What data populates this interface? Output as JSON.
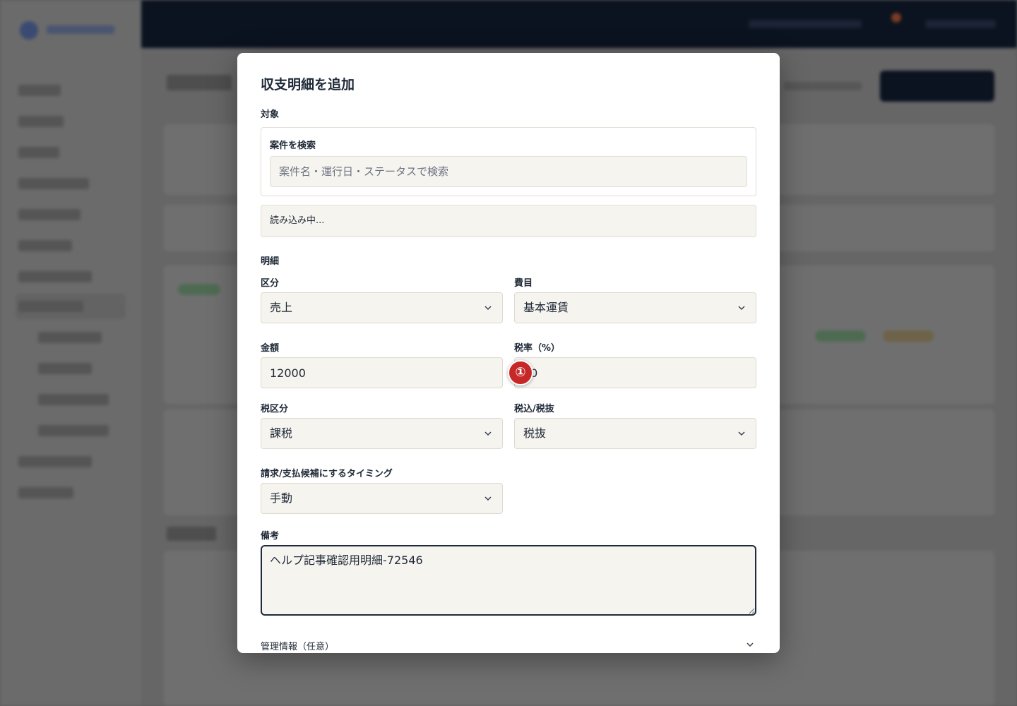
{
  "modal": {
    "title": "収支明細を追加",
    "target_section": "対象",
    "search": {
      "label": "案件を検索",
      "placeholder": "案件名・運行日・ステータスで検索",
      "value": ""
    },
    "loading_text": "読み込み中...",
    "detail_section": "明細",
    "fields": {
      "category": {
        "label": "区分",
        "value": "売上"
      },
      "item": {
        "label": "費目",
        "value": "基本運賃"
      },
      "amount": {
        "label": "金額",
        "value": "12000"
      },
      "tax_rate": {
        "label": "税率（%）",
        "value": "10"
      },
      "tax_class": {
        "label": "税区分",
        "value": "課税"
      },
      "tax_mode": {
        "label": "税込/税抜",
        "value": "税抜"
      },
      "timing": {
        "label": "請求/支払候補にするタイミング",
        "value": "手動"
      },
      "note": {
        "label": "備考",
        "value": "ヘルプ記事確認用明細-72546"
      }
    },
    "admin_info": {
      "label": "管理情報（任意）"
    }
  },
  "annotation": {
    "marker_label": "①",
    "color": "#c62828"
  },
  "colors": {
    "accent_dark": "#0b1220",
    "field_bg": "#f6f4ef",
    "border": "#e2ded5"
  }
}
